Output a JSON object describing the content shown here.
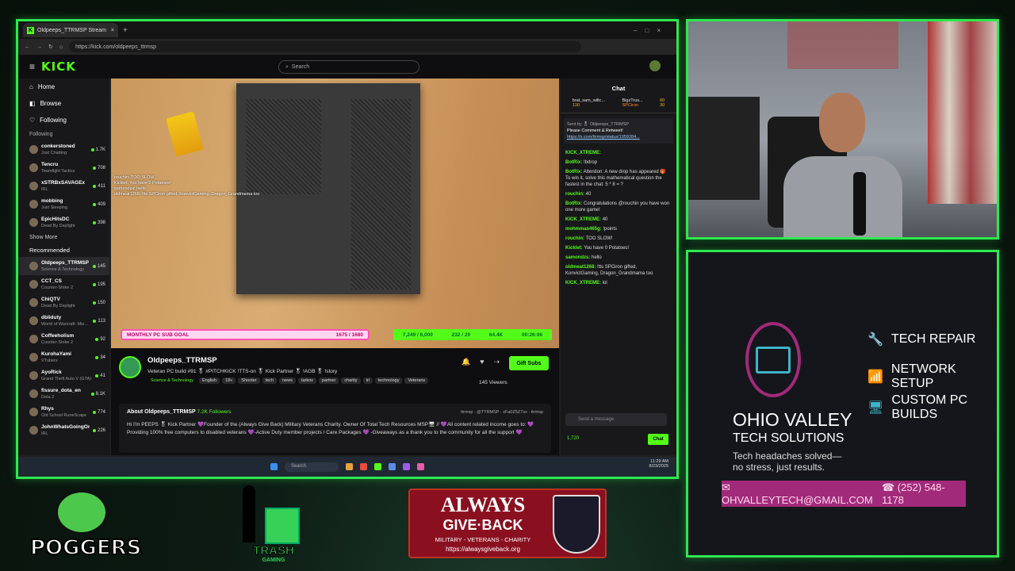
{
  "browser": {
    "tab_title": "Oldpeeps_TTRMSP Stream",
    "url": "https://kick.com/oldpeeps_ttrmsp"
  },
  "kick": {
    "logo": "KICK",
    "search_placeholder": "Search",
    "nav": [
      "Home",
      "Browse",
      "Following"
    ],
    "following_header": "Following",
    "following": [
      {
        "name": "conkerstoned",
        "sub": "Just Chatting",
        "v": "1.7K"
      },
      {
        "name": "Tencru",
        "sub": "Teamfight Tactics",
        "v": "708"
      },
      {
        "name": "xSTRBxSAVAGEx",
        "sub": "IRL",
        "v": "411"
      },
      {
        "name": "mobbing",
        "sub": "Just Sleeping",
        "v": "409"
      },
      {
        "name": "EpicHitsDC",
        "sub": "Dead By Daylight",
        "v": "398"
      }
    ],
    "show_more": "Show More",
    "recommended_header": "Recommended",
    "recommended": [
      {
        "name": "Oldpeeps_TTRMSP",
        "sub": "Science & Technology",
        "v": "145"
      },
      {
        "name": "CCT_CS",
        "sub": "Counter-Strike 2",
        "v": "195"
      },
      {
        "name": "ChiQTV",
        "sub": "Dead By Daylight",
        "v": "150"
      },
      {
        "name": "dbliduty",
        "sub": "World of Warcraft: Mis...",
        "v": "113"
      },
      {
        "name": "Coffeeholism",
        "sub": "Counter-Strike 2",
        "v": "92"
      },
      {
        "name": "KurohaYami",
        "sub": "VTubers",
        "v": "34"
      },
      {
        "name": "AyoRick",
        "sub": "Grand Theft Auto V (GTA)",
        "v": "41"
      },
      {
        "name": "fissure_dota_en",
        "sub": "Dota 2",
        "v": "8.1K"
      },
      {
        "name": "Rhys",
        "sub": "Old School RuneScape",
        "v": "774"
      },
      {
        "name": "JohnWhatsGoingOn",
        "sub": "IRL",
        "v": "226"
      }
    ],
    "sub_goal_label": "MONTHLY PC SUB GOAL",
    "sub_goal_value": "1675 / 1680",
    "goal_stats": [
      "7,249 / 6,000",
      "232 / 20",
      "64.4K",
      "00:26:06"
    ],
    "streamer": "Oldpeeps_TTRMSP",
    "stream_title": "Veteran PC build #91 🎖 #PITCHKICK !TTS-on 🎖 Kick Partner 🎖 !AGB 🎖 !story",
    "tags": [
      "Science & Technology",
      "English",
      "18+",
      "Shooter",
      "tech",
      "news",
      "tarkov",
      "partner",
      "charity",
      "irl",
      "technology",
      "Veterans"
    ],
    "gift_label": "Gift Subs",
    "viewers": "145 Viewers",
    "about_title": "About Oldpeeps_TTRMSP",
    "followers": "7.2K Followers",
    "socials": [
      "ttrmsp",
      "@TTRMSP",
      "xFa0Z5Z7ss",
      "ttrmsp"
    ],
    "about_text": "Hi I'm PEEPS 🎖 Kick Partner 💜Founder of the (Always Give Back) Military Veterans Charity. Owner Of Total Tech Resources MSP🖥 // 💜All content related income goes to: 💜Providing 100% free computers to disabled veterans 💜-Active Duty member projects / Care Packages 💜 -Giveaways as a thank you to the community for all the support 💜",
    "chat_title": "Chat",
    "pinned_users": [
      "brat_sam_wiltc...",
      "BigzTrus...",
      "SPCiron"
    ],
    "pinned_vals": [
      "130",
      "60",
      "30"
    ],
    "pin_by": "Sent by 🎖 Oldpeeps_TTRMSP",
    "pin_text": "Please Comment & Retweet!",
    "pin_link": "https://x.com/ttrmsp/status/1959284...",
    "messages": [
      {
        "u": "KICK_XTREME:",
        "t": ""
      },
      {
        "u": "BotRix:",
        "t": "!bdrop"
      },
      {
        "u": "BotRix:",
        "t": "Attention: A new drop has appeared 🎁 To win it, solve this mathematical question the fastest in the chat: 5 * 8 = ?"
      },
      {
        "u": "rouchin:",
        "t": "40"
      },
      {
        "u": "BotRix:",
        "t": "Congratulations @rouchin you have won one more game!"
      },
      {
        "u": "KICK_XTREME:",
        "t": "40"
      },
      {
        "u": "mohmmas465g:",
        "t": "!points"
      },
      {
        "u": "rouchin:",
        "t": "TOO SLOW!"
      },
      {
        "u": "Kicklet:",
        "t": "You have 0 Potatoes!"
      },
      {
        "u": "samondzs:",
        "t": "hello"
      },
      {
        "u": "oldmeat1268:",
        "t": "!tts SPCiron gifted, KonvictGaming, Dragon_Grandmama too"
      },
      {
        "u": "KICK_XTREME:",
        "t": "lol"
      }
    ],
    "chat_placeholder": "Send a message",
    "points": "1,720",
    "chat_button": "Chat",
    "overlay_chat": [
      "rouchin: TOO SLOW",
      "Kicklet: You have 0 Potatoes!",
      "samondzs: hello",
      "oldmeat1268: !tts SPCiron gifted, KonvictGaming, Dragon_Grandmama too"
    ]
  },
  "taskbar": {
    "search": "Search",
    "time": "11:29 AM",
    "date": "8/23/2025"
  },
  "sponsor": {
    "name_line1": "OHIO VALLEY",
    "name_line2": "TECH SOLUTIONS",
    "tagline": "Tech headaches solved—\nno stress, just results.",
    "services": [
      "TECH REPAIR",
      "NETWORK SETUP",
      "CUSTOM PC BUILDS"
    ],
    "email": "OHVALLEYTECH@GMAIL.COM",
    "phone": "(252) 548-1178"
  },
  "logos": {
    "poggers": "POGGERS",
    "trash": "TRASH",
    "trash_sub": "GAMING",
    "agb_line1": "ALWAYS",
    "agb_line2": "GIVE·BACK",
    "agb_line3": "MILITARY - VETERANS - CHARITY",
    "agb_url": "https://alwaysgiveback.org"
  },
  "colors": {
    "frame": "#2ee84f",
    "kick": "#53fc18",
    "sponsor_accent": "#a12a7a"
  }
}
